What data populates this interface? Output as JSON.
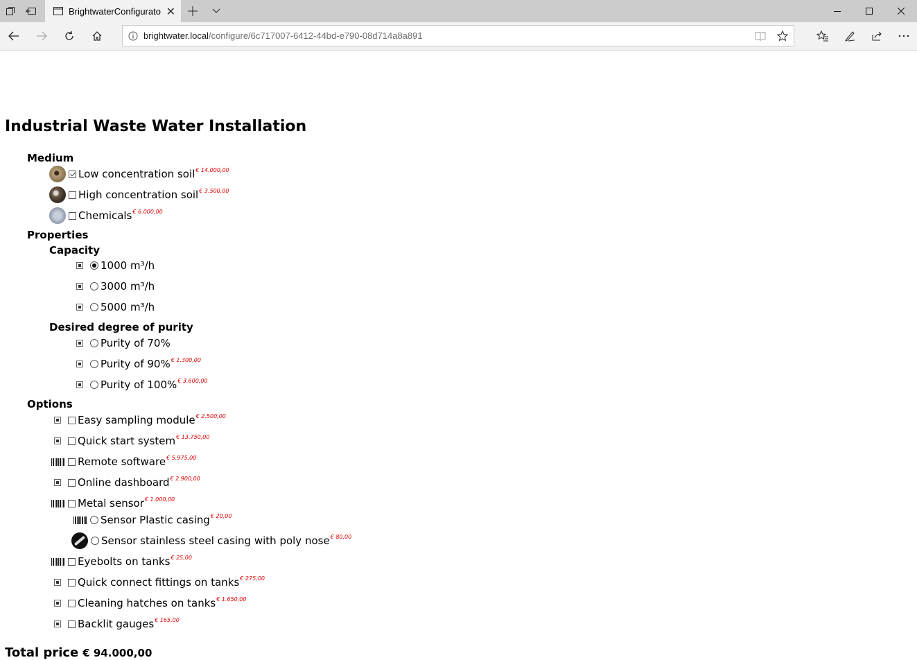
{
  "browser": {
    "tab_title": "BrightwaterConfigurato",
    "url_host": "brightwater.local",
    "url_path": "/configure/6c717007-6412-44bd-e790-08d714a8a891"
  },
  "page": {
    "title": "Industrial Waste Water Installation",
    "sections": {
      "medium": {
        "heading": "Medium",
        "items": [
          {
            "label": "Low concentration soil",
            "price": "€ 14.000,00",
            "checked": true,
            "icon": "soil-low-thumbnail"
          },
          {
            "label": "High concentration soil",
            "price": "€ 3.500,00",
            "checked": false,
            "icon": "soil-high-thumbnail"
          },
          {
            "label": "Chemicals",
            "price": "€ 6.000,00",
            "checked": false,
            "icon": "chemicals-thumbnail"
          }
        ]
      },
      "properties": {
        "heading": "Properties",
        "capacity": {
          "heading": "Capacity",
          "items": [
            {
              "label": "1000 m³/h",
              "price": "",
              "selected": true
            },
            {
              "label": "3000 m³/h",
              "price": "",
              "selected": false
            },
            {
              "label": "5000 m³/h",
              "price": "",
              "selected": false
            }
          ]
        },
        "purity": {
          "heading": "Desired degree of purity",
          "items": [
            {
              "label": "Purity of 70%",
              "price": "",
              "selected": false
            },
            {
              "label": "Purity of 90%",
              "price": "€ 1.300,00",
              "selected": false
            },
            {
              "label": "Purity of 100%",
              "price": "€ 3.600,00",
              "selected": false
            }
          ]
        }
      },
      "options": {
        "heading": "Options",
        "items": [
          {
            "label": "Easy sampling module",
            "price": "€ 2.500,00",
            "icon": "broken-image-icon"
          },
          {
            "label": "Quick start system",
            "price": "€ 13.750,00",
            "icon": "broken-image-icon"
          },
          {
            "label": "Remote software",
            "price": "€ 5.975,00",
            "icon": "barcode-icon"
          },
          {
            "label": "Online dashboard",
            "price": "€ 2.900,00",
            "icon": "broken-image-icon"
          },
          {
            "label": "Metal sensor",
            "price": "€ 1.000,00",
            "icon": "barcode-icon"
          },
          {
            "label": "Eyebolts on tanks",
            "price": "€ 25,00",
            "icon": "barcode-icon"
          },
          {
            "label": "Quick connect fittings on tanks",
            "price": "€ 275,00",
            "icon": "broken-image-icon"
          },
          {
            "label": "Cleaning hatches on tanks",
            "price": "€ 1.650,00",
            "icon": "broken-image-icon"
          },
          {
            "label": "Backlit gauges",
            "price": "€ 165,00",
            "icon": "broken-image-icon"
          }
        ],
        "metal_sensor_sub": [
          {
            "label": "Sensor Plastic casing",
            "price": "€ 20,00",
            "icon": "barcode-icon"
          },
          {
            "label": "Sensor stainless steel casing with poly nose",
            "price": "€ 80,00",
            "icon": "steel-casing-thumbnail"
          }
        ]
      }
    },
    "total": {
      "label": "Total price",
      "value": "€ 94.000,00"
    }
  }
}
